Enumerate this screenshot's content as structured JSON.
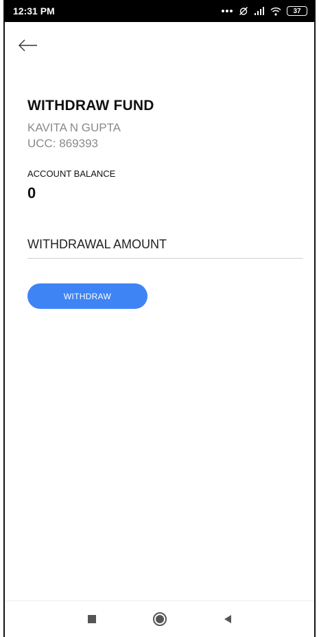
{
  "status_bar": {
    "time": "12:31 PM",
    "battery": "37"
  },
  "header": {
    "back_icon": "arrow-left-icon"
  },
  "main": {
    "title": "WITHDRAW FUND",
    "client_name": "KAVITA N GUPTA",
    "ucc": "UCC: 869393",
    "balance_label": "ACCOUNT BALANCE",
    "balance_value": "0",
    "amount_placeholder": "WITHDRAWAL AMOUNT",
    "amount_value": "",
    "withdraw_label": "WITHDRAW"
  },
  "nav": {
    "recents_icon": "square-icon",
    "home_icon": "circle-icon",
    "back_icon": "triangle-back-icon"
  },
  "colors": {
    "accent": "#3f84f4",
    "muted_text": "#8a8a8a",
    "status_bar": "#000000"
  }
}
